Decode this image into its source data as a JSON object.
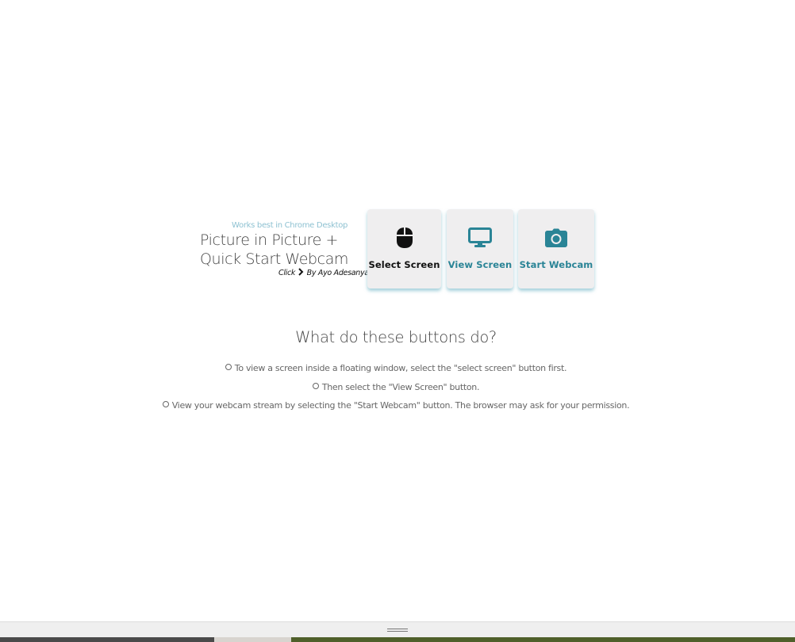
{
  "header": {
    "note": "Works best in Chrome Desktop",
    "title_line1": "Picture in Picture +",
    "title_line2": "Quick Start Webcam",
    "byline_click": "Click",
    "byline_author": "By Ayo Adesanya"
  },
  "buttons": [
    {
      "label": "Select Screen",
      "icon": "mouse-icon",
      "color": "#111111"
    },
    {
      "label": "View Screen",
      "icon": "desktop-icon",
      "color": "#2a8496"
    },
    {
      "label": "Start Webcam",
      "icon": "camera-icon",
      "color": "#2a8496"
    }
  ],
  "help": {
    "title": "What do these buttons do?",
    "items": [
      "To view a screen inside a floating window, select the \"select screen\" button first.",
      "Then select the \"View Screen\" button.",
      "View your webcam stream by selecting the \"Start Webcam\" button. The browser may ask for your permission."
    ]
  },
  "colors": {
    "accent": "#2a8496",
    "note": "#8fc2d2",
    "button_bg": "#efeeef",
    "strip": [
      "#4a4a4a",
      "#d8d4cf",
      "#4f5f2a"
    ]
  }
}
